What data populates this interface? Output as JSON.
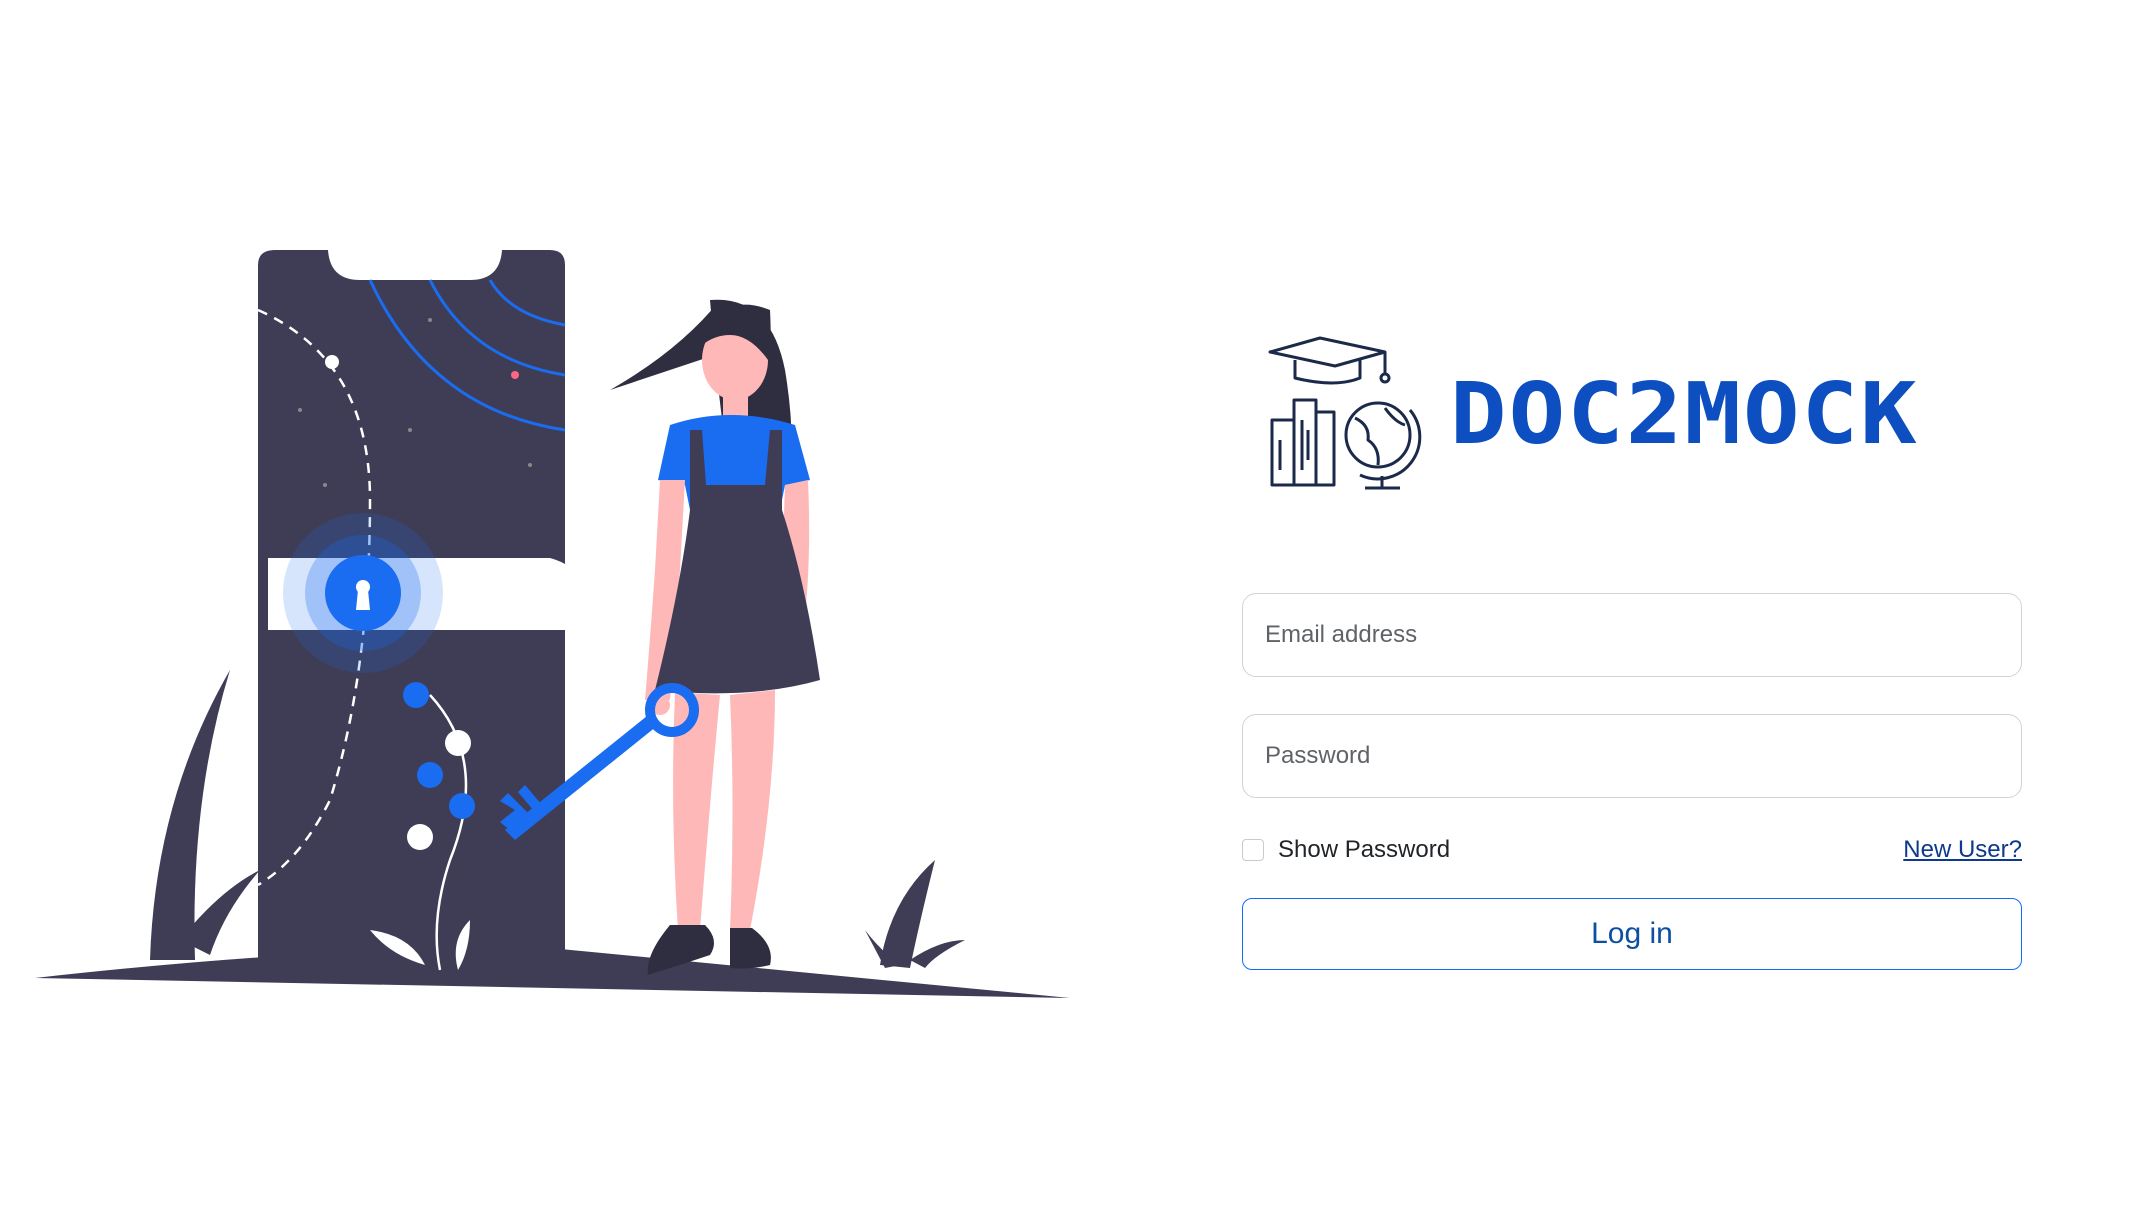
{
  "illustration": {
    "colors": {
      "dark": "#3f3d56",
      "accent": "#1a6cf0",
      "skin": "#ffb8b8",
      "white": "#ffffff"
    }
  },
  "logo": {
    "icon": "graduation-cap-books-globe-icon",
    "text": "DOC2MOCK",
    "color": "#0d4fc0"
  },
  "form": {
    "email_placeholder": "Email address",
    "password_placeholder": "Password",
    "show_password_label": "Show Password",
    "show_password_checked": false,
    "new_user_link": "New User?",
    "login_button": "Log in",
    "accent_color": "#0d6efd"
  }
}
